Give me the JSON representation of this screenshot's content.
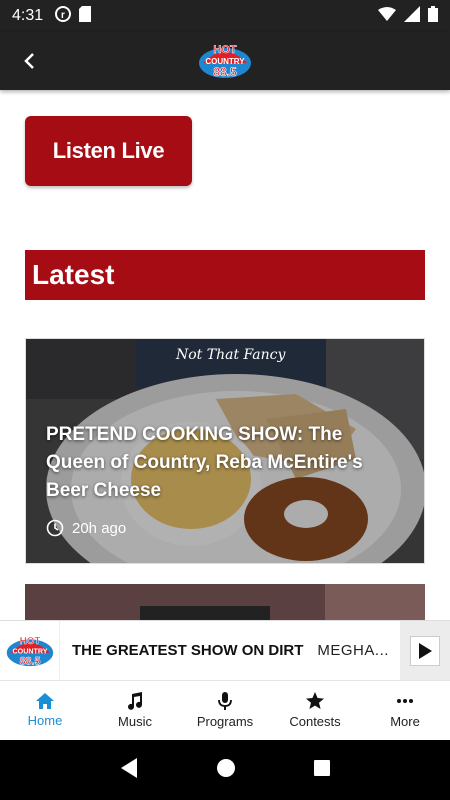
{
  "status_bar": {
    "time": "4:31"
  },
  "app_bar": {
    "logo_lines": [
      "HOT",
      "COUNTRY",
      "88.5"
    ]
  },
  "listen_live": {
    "label": "Listen Live"
  },
  "section": {
    "title": "Latest"
  },
  "article": {
    "title": "PRETEND COOKING SHOW: The Queen of Country, Reba McEntire's Beer Cheese",
    "time": "20h ago",
    "image_caption": "Not That Fancy"
  },
  "player": {
    "title": "THE GREATEST SHOW ON DIRT",
    "artist": "MEGHA..."
  },
  "tabs": [
    {
      "label": "Home",
      "icon": "home-icon",
      "active": true
    },
    {
      "label": "Music",
      "icon": "music-note-icon",
      "active": false
    },
    {
      "label": "Programs",
      "icon": "microphone-icon",
      "active": false
    },
    {
      "label": "Contests",
      "icon": "star-icon",
      "active": false
    },
    {
      "label": "More",
      "icon": "more-dots-icon",
      "active": false
    }
  ],
  "colors": {
    "brand_red": "#a50c14",
    "active_tab": "#1a8fd6",
    "bar_dark": "#222222"
  }
}
